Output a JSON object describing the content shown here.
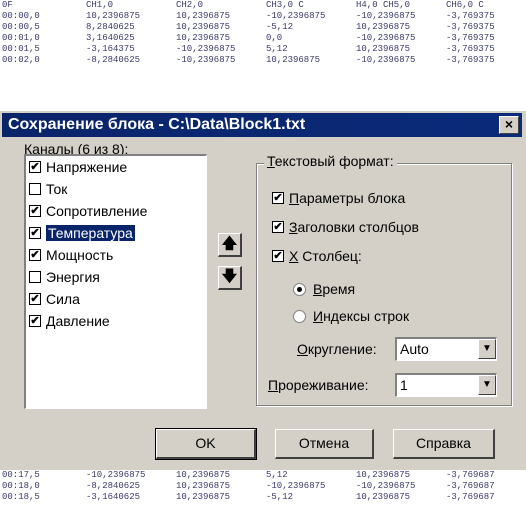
{
  "bg_top_rows": [
    [
      "0F",
      "CH1,0",
      "CH2,0",
      "CH3,0   C",
      "H4,0   CH5,0",
      "CH6,0   C"
    ],
    [
      "00:00,0",
      "10,2396875",
      "10,2396875",
      "-10,2396875",
      "-10,2396875",
      "-3,769375"
    ],
    [
      "00:00,5",
      "8,2840625",
      "10,2396875",
      "-5,12",
      "10,2396875",
      "-3,769375"
    ],
    [
      "00:01,0",
      "3,1640625",
      "10,2396875",
      "0,0",
      "-10,2396875",
      "-3,769375"
    ],
    [
      "00:01,5",
      "-3,164375",
      "-10,2396875",
      "5,12",
      "10,2396875",
      "-3,769375"
    ],
    [
      "00:02,0",
      "-8,2840625",
      "-10,2396875",
      "10,2396875",
      "-10,2396875",
      "-3,769375"
    ]
  ],
  "bg_bottom_rows": [
    [
      "00:17,5",
      "-10,2396875",
      "10,2396875",
      "5,12",
      "10,2396875",
      "-3,769687"
    ],
    [
      "00:18,0",
      "-8,2840625",
      "10,2396875",
      "-10,2396875",
      "-10,2396875",
      "-3,769687"
    ],
    [
      "00:18,5",
      "-3,1640625",
      "10,2396875",
      "-5,12",
      "10,2396875",
      "-3,769687"
    ]
  ],
  "dialog": {
    "title": "Сохранение блока - C:\\Data\\Block1.txt",
    "close_glyph": "×"
  },
  "channels": {
    "label_underlined": "К",
    "label_rest": "аналы (6 из 8):",
    "items": [
      {
        "label": "Напряжение",
        "checked": true
      },
      {
        "label": "Ток",
        "checked": false
      },
      {
        "label": "Сопротивление",
        "checked": true
      },
      {
        "label": "Температура",
        "checked": true,
        "selected": true
      },
      {
        "label": "Мощность",
        "checked": true
      },
      {
        "label": "Энергия",
        "checked": false
      },
      {
        "label": "Сила",
        "checked": true
      },
      {
        "label": "Давление",
        "checked": true
      }
    ],
    "up_glyph": "🡅",
    "down_glyph": "🡇"
  },
  "format": {
    "title_underlined": "Т",
    "title_rest": "екстовый формат:",
    "block_params": {
      "u": "П",
      "rest": "араметры блока"
    },
    "column_headers": {
      "u": "З",
      "rest": "аголовки столбцов"
    },
    "x_column": {
      "u": "Х",
      "rest": " Столбец:"
    },
    "time": {
      "u": "В",
      "rest": "ремя"
    },
    "row_indices": {
      "u": "И",
      "rest": "ндексы строк"
    },
    "rounding_label_u": "О",
    "rounding_label_rest": "кругление:",
    "rounding_value": "Auto",
    "decimation_label_u": "П",
    "decimation_label_rest": "рореживание:",
    "decimation_value": "1",
    "checkmark": "✔",
    "dropdown_glyph": "▼"
  },
  "buttons": {
    "ok": "OK",
    "cancel": "Отмена",
    "help": "Справка"
  }
}
